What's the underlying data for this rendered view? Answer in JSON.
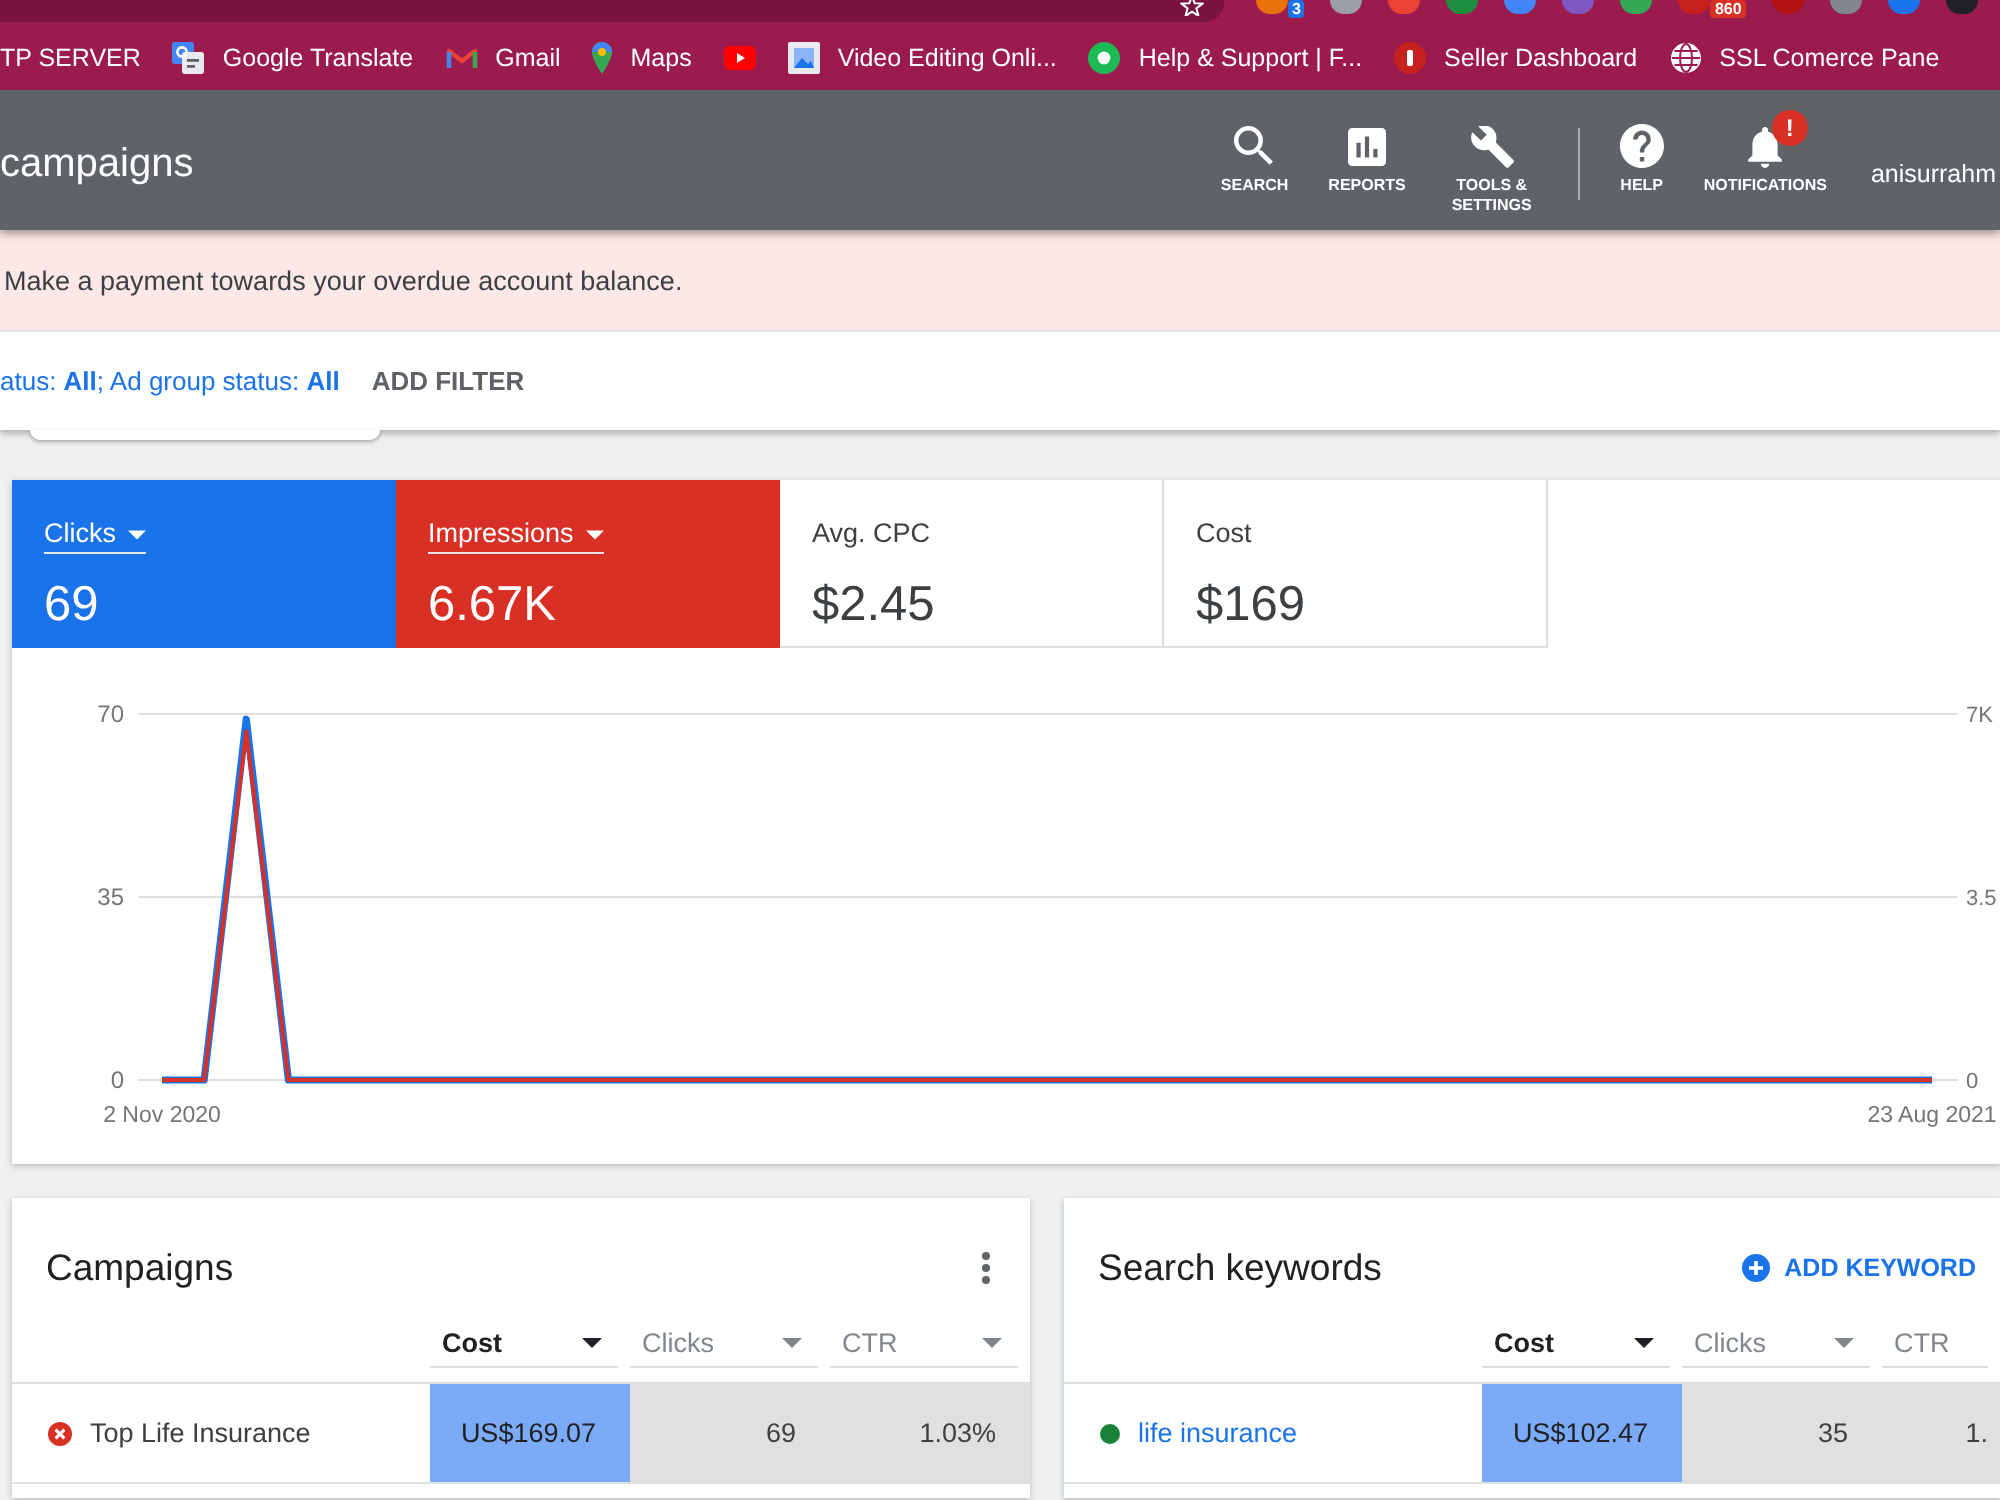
{
  "browser": {
    "extensions": [
      {
        "color": "#e8710a",
        "badge": {
          "text": "3",
          "color": "#1a73e8"
        }
      },
      {
        "color": "#9aa0a6"
      },
      {
        "color": "#ea4335"
      },
      {
        "color": "#1e8e3e"
      },
      {
        "color": "#4285f4"
      },
      {
        "color": "#7e57c2"
      },
      {
        "color": "#34a853"
      },
      {
        "color": "#c5221f",
        "badge": {
          "text": "860",
          "color": "#d93025"
        }
      },
      {
        "color": "#b31412"
      },
      {
        "color": "#80868b"
      },
      {
        "color": "#1a73e8"
      },
      {
        "color": "#202124"
      }
    ],
    "bookmarks": [
      {
        "kind": "text",
        "label": "TP SERVER"
      },
      {
        "kind": "translate",
        "label": "Google Translate"
      },
      {
        "kind": "mail",
        "label": "Gmail"
      },
      {
        "kind": "pin",
        "label": "Maps"
      },
      {
        "kind": "video"
      },
      {
        "kind": "image",
        "label": "Video Editing Onli..."
      },
      {
        "kind": "fi",
        "label": "Help & Support | F..."
      },
      {
        "kind": "seller",
        "label": "Seller Dashboard"
      },
      {
        "kind": "globe",
        "label": "SSL Comerce Pane"
      }
    ]
  },
  "header": {
    "title": "campaigns",
    "tools": [
      {
        "kind": "search",
        "separated": false,
        "label": "SEARCH"
      },
      {
        "kind": "reports",
        "separated": false,
        "label": "REPORTS"
      },
      {
        "kind": "tools",
        "separated": false,
        "label": "TOOLS & SETTINGS"
      },
      {
        "kind": "help",
        "separated": true,
        "label": "HELP"
      },
      {
        "kind": "notifications",
        "separated": false,
        "label": "NOTIFICATIONS",
        "badge": "!"
      }
    ],
    "account": "anisurrahm"
  },
  "alert": {
    "message": "Make a payment towards your overdue account balance."
  },
  "filter": {
    "summary": "atus: **All**; Ad group status: **All**",
    "action": "ADD FILTER"
  },
  "metrics": {
    "tiles": [
      {
        "label": "Clicks",
        "value": "69",
        "selected": true,
        "color": "#1a73e8"
      },
      {
        "label": "Impressions",
        "value": "6.67K",
        "selected": true,
        "color": "#d93025"
      },
      {
        "label": "Avg. CPC",
        "value": "$2.45",
        "selected": false
      },
      {
        "label": "Cost",
        "value": "$169",
        "selected": false
      }
    ],
    "chart_data": {
      "type": "line",
      "categories": [
        "2 Nov 2020",
        null,
        null,
        null,
        null,
        null,
        null,
        null,
        null,
        null,
        null,
        null,
        null,
        null,
        null,
        null,
        null,
        null,
        null,
        null,
        null,
        null,
        null,
        null,
        null,
        null,
        null,
        null,
        null,
        null,
        null,
        null,
        null,
        null,
        null,
        null,
        null,
        null,
        null,
        null,
        null,
        null,
        "23 Aug 2021"
      ],
      "ylim": [
        0,
        70
      ],
      "yticks": [
        0,
        35,
        70
      ],
      "y2lim": [
        0,
        7
      ],
      "y2ticks": [
        0,
        3.5,
        {
          "value": 7,
          "label": "7K"
        }
      ],
      "series": [
        {
          "color": "#1a73e8",
          "values": [
            0,
            0,
            69,
            0,
            0,
            0,
            0,
            0,
            0,
            0,
            0,
            0,
            0,
            0,
            0,
            0,
            0,
            0,
            0,
            0,
            0,
            0,
            0,
            0,
            0,
            0,
            0,
            0,
            0,
            0,
            0,
            0,
            0,
            0,
            0,
            0,
            0,
            0,
            0,
            0,
            0,
            0,
            0
          ]
        },
        {
          "color": "#d93025",
          "axis": "y2",
          "values": [
            0,
            0,
            6.67,
            0,
            0,
            0,
            0,
            0,
            0,
            0,
            0,
            0,
            0,
            0,
            0,
            0,
            0,
            0,
            0,
            0,
            0,
            0,
            0,
            0,
            0,
            0,
            0,
            0,
            0,
            0,
            0,
            0,
            0,
            0,
            0,
            0,
            0,
            0,
            0,
            0,
            0,
            0,
            0
          ]
        }
      ]
    }
  },
  "cards": [
    {
      "title": "Campaigns",
      "menu": true,
      "columns": [
        {
          "label": "Cost",
          "sorted": true,
          "dropdown": true
        },
        {
          "label": "Clicks",
          "sorted": false,
          "dropdown": true
        },
        {
          "label": "CTR",
          "sorted": false,
          "dropdown": true
        }
      ],
      "rows": [
        {
          "enabled": false,
          "link": false,
          "name": "Top Life Insurance",
          "cells": [
            "US$169.07",
            "69",
            "1.03%"
          ]
        }
      ]
    },
    {
      "title": "Search keywords",
      "action": "ADD KEYWORD",
      "columns": [
        {
          "label": "Cost",
          "sorted": true,
          "dropdown": true
        },
        {
          "label": "Clicks",
          "sorted": false,
          "dropdown": true
        },
        {
          "label": "CTR",
          "sorted": false,
          "dropdown": false
        }
      ],
      "rows": [
        {
          "enabled": true,
          "link": true,
          "name": "life insurance",
          "cells": [
            "US$102.47",
            "35",
            "1."
          ]
        }
      ]
    }
  ]
}
